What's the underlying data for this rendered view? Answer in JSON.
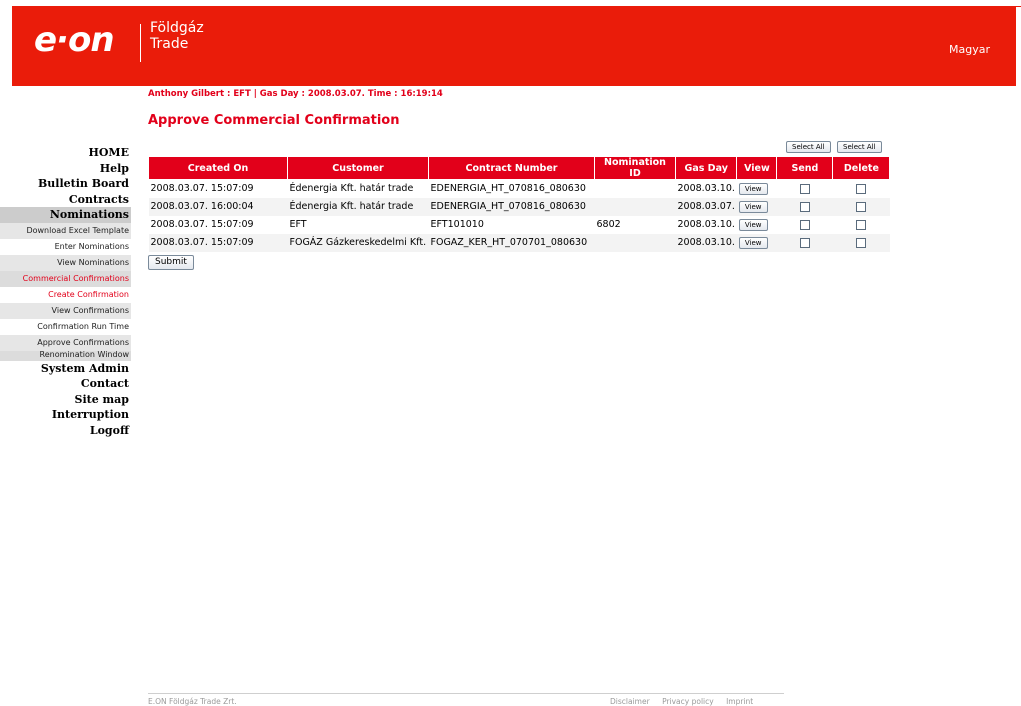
{
  "header": {
    "logo_text": "e·on",
    "brand_line1": "Földgáz",
    "brand_line2": "Trade",
    "language_link": "Magyar"
  },
  "user_info": "Anthony Gilbert : EFT | Gas Day : 2008.03.07. Time : 16:19:14",
  "page_title": "Approve Commercial Confirmation",
  "nav": {
    "home": "HOME",
    "help": "Help",
    "bulletin_board": "Bulletin Board",
    "contracts": "Contracts",
    "nominations": "Nominations",
    "download_excel_template": "Download Excel Template",
    "enter_nominations": "Enter Nominations",
    "view_nominations": "View Nominations",
    "commercial_confirmations": "Commercial Confirmations",
    "create_confirmation": "Create Confirmation",
    "view_confirmations": "View Confirmations",
    "confirmation_run_time": "Confirmation Run Time",
    "approve_confirmations": "Approve Confirmations",
    "renomination_window": "Renomination Window",
    "system_admin": "System Admin",
    "contact": "Contact",
    "site_map": "Site map",
    "interruption": "Interruption",
    "logoff": "Logoff"
  },
  "select_all": {
    "send_label": "Select All",
    "delete_label": "Select All"
  },
  "table": {
    "headers": {
      "created_on": "Created On",
      "customer": "Customer",
      "contract_number": "Contract Number",
      "nomination_id": "Nomination ID",
      "gas_day": "Gas Day",
      "view": "View",
      "send": "Send",
      "delete": "Delete"
    },
    "view_label": "View",
    "rows": [
      {
        "created_on": "2008.03.07. 15:07:09",
        "customer": "Édenergia Kft. határ trade",
        "contract_number": "EDENERGIA_HT_070816_080630",
        "nomination_id": "",
        "gas_day": "2008.03.10."
      },
      {
        "created_on": "2008.03.07. 16:00:04",
        "customer": "Édenergia Kft. határ trade",
        "contract_number": "EDENERGIA_HT_070816_080630",
        "nomination_id": "",
        "gas_day": "2008.03.07."
      },
      {
        "created_on": "2008.03.07. 15:07:09",
        "customer": "EFT",
        "contract_number": "EFT101010",
        "nomination_id": "6802",
        "gas_day": "2008.03.10."
      },
      {
        "created_on": "2008.03.07. 15:07:09",
        "customer": "FOGÁZ Gázkereskedelmi Kft.",
        "contract_number": "FOGAZ_KER_HT_070701_080630",
        "nomination_id": "",
        "gas_day": "2008.03.10."
      }
    ]
  },
  "submit_label": "Submit",
  "footer": {
    "company": "E.ON Földgáz Trade Zrt.",
    "disclaimer": "Disclaimer",
    "privacy_policy": "Privacy policy",
    "imprint": "Imprint"
  },
  "colors": {
    "brand_red": "#ea1c0a",
    "text_red": "#e2001a",
    "nav_active_bg": "#cccccc"
  }
}
